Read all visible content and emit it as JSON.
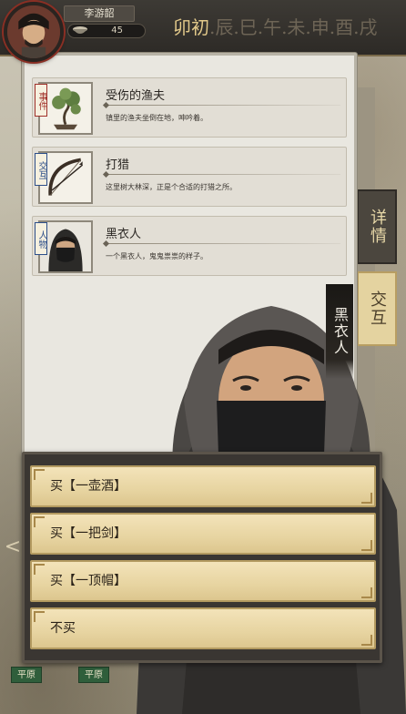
{
  "player": {
    "name": "李游韶",
    "stamina": "45",
    "avatar_icon": "player-portrait"
  },
  "time": {
    "current": "卯初",
    "rest": ".辰.巳.午.未.申.酉.戌"
  },
  "tabs": {
    "detail": "详情",
    "interact": "交互"
  },
  "cards": [
    {
      "tag": "事件",
      "title": "受伤的渔夫",
      "desc": "镇里的渔夫坐倒在地，呻吟着。",
      "icon": "bonsai-icon"
    },
    {
      "tag": "交互",
      "title": "打猎",
      "desc": "这里树大林深，正是个合适的打猎之所。",
      "icon": "bow-icon"
    },
    {
      "tag": "人物",
      "title": "黑衣人",
      "desc": "一个黑衣人，鬼鬼祟祟的样子。",
      "icon": "masked-man-icon"
    }
  ],
  "character": {
    "name": "黑衣人"
  },
  "options": [
    {
      "label": "买【一壶酒】"
    },
    {
      "label": "买【一把剑】"
    },
    {
      "label": "买【一顶帽】"
    },
    {
      "label": "不买"
    }
  ],
  "map": {
    "nodes": [
      "平原",
      "平原"
    ],
    "back_arrow": "<"
  },
  "colors": {
    "accent_gold": "#e2c98a",
    "option_bg": "#e7d4a1",
    "event_red": "#a0302a",
    "interact_blue": "#2d4f8a"
  }
}
